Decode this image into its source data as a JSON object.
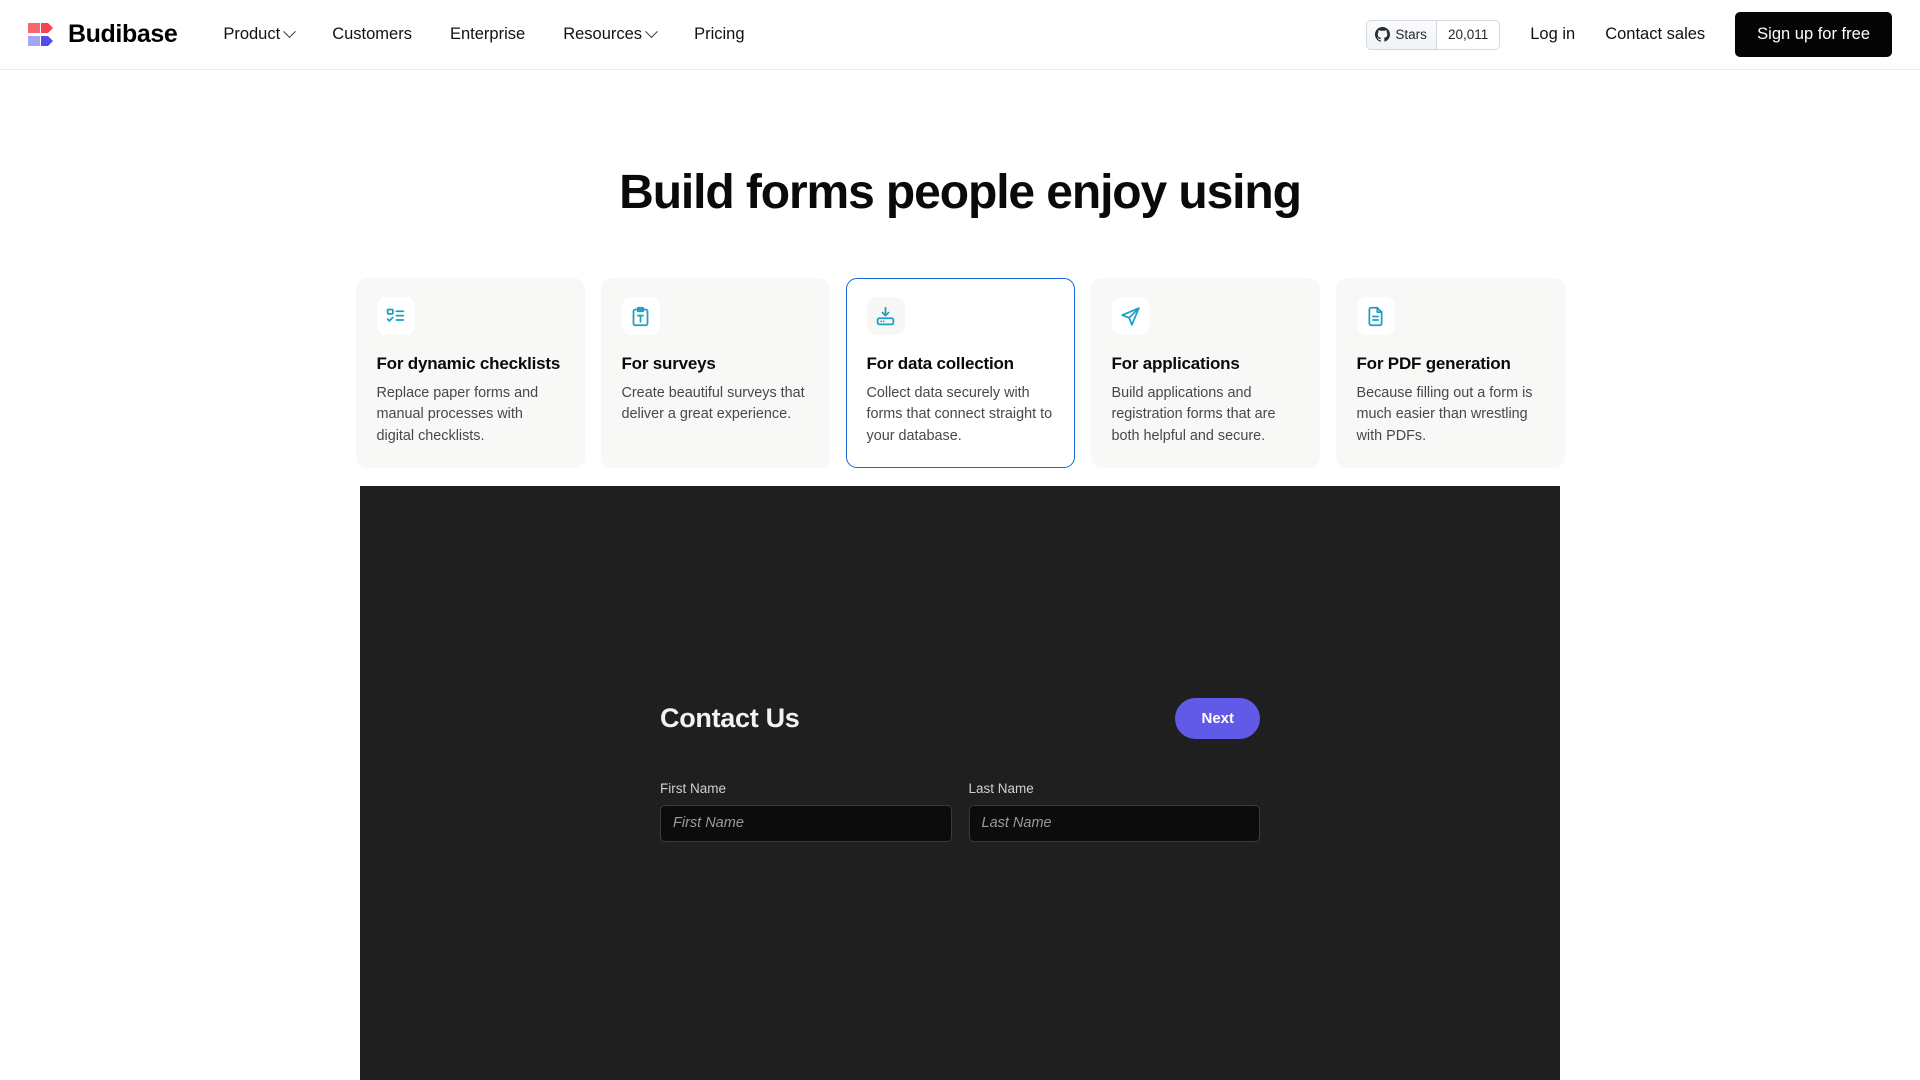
{
  "header": {
    "brand": {
      "name": "Budibase",
      "logo_icon": "budibase-logo-icon"
    },
    "nav_links": [
      {
        "label": "Product",
        "has_dropdown": true
      },
      {
        "label": "Customers",
        "has_dropdown": false
      },
      {
        "label": "Enterprise",
        "has_dropdown": false
      },
      {
        "label": "Resources",
        "has_dropdown": true
      },
      {
        "label": "Pricing",
        "has_dropdown": false
      }
    ],
    "github_badge": {
      "icon": "github-icon",
      "label": "Stars",
      "count": "20,011"
    },
    "login_label": "Log in",
    "contact_sales_label": "Contact sales",
    "signup_label": "Sign up for free"
  },
  "hero": {
    "title": "Build forms people enjoy using"
  },
  "cards": [
    {
      "icon": "checklist-icon",
      "title": "For dynamic checklists",
      "desc": "Replace paper forms and manual processes with digital checklists.",
      "active": false
    },
    {
      "icon": "clipboard-text-icon",
      "title": "For surveys",
      "desc": "Create beautiful surveys that deliver a great experience.",
      "active": false
    },
    {
      "icon": "data-collection-icon",
      "title": "For data collection",
      "desc": "Collect data securely with forms that connect straight to your database.",
      "active": true
    },
    {
      "icon": "send-icon",
      "title": "For applications",
      "desc": "Build applications and registration forms that are both helpful and secure.",
      "active": false
    },
    {
      "icon": "file-text-icon",
      "title": "For PDF generation",
      "desc": "Because filling out a form is much easier than wrestling with PDFs.",
      "active": false
    }
  ],
  "preview_form": {
    "title": "Contact Us",
    "next_label": "Next",
    "fields": [
      {
        "label": "First Name",
        "placeholder": "First Name",
        "value": ""
      },
      {
        "label": "Last Name",
        "placeholder": "Last Name",
        "value": ""
      }
    ]
  },
  "colors": {
    "accent_blue": "#1668d8",
    "icon_teal": "#1b9fc4",
    "panel_bg": "#1f1f1f",
    "next_purple": "#6159e8",
    "cta_black": "#050505",
    "logo_red": "#f7666f",
    "logo_red_dark": "#f8424f",
    "logo_purple_light": "#a6a4f5",
    "logo_purple_dark": "#554ee6"
  }
}
